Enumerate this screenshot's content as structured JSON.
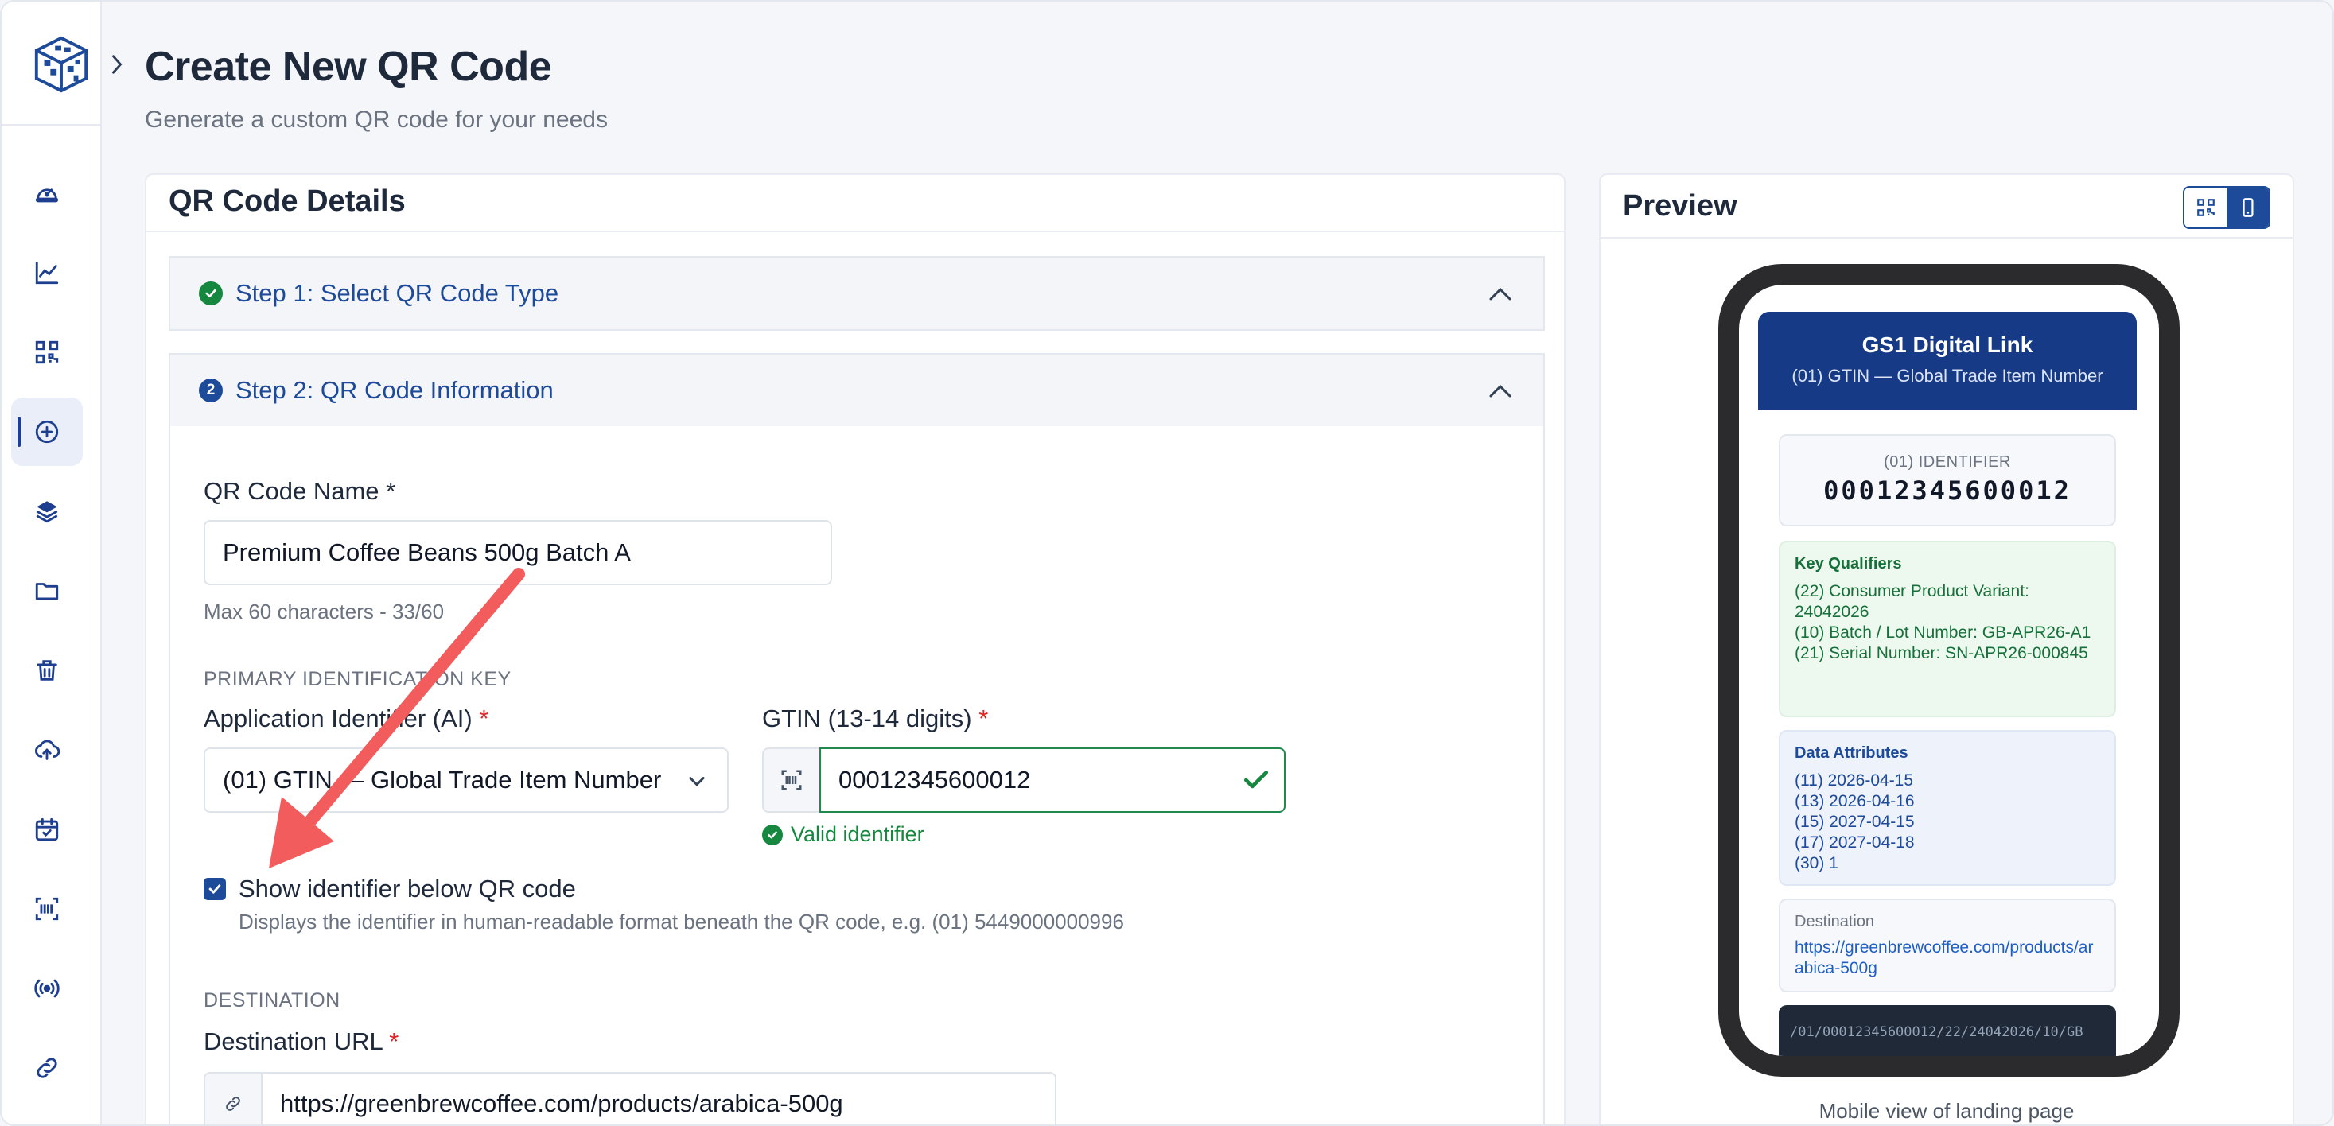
{
  "header": {
    "title": "Create New QR Code",
    "subtitle": "Generate a custom QR code for your needs"
  },
  "sidebar": {
    "items": [
      {
        "name": "dashboard",
        "icon": "gauge-icon"
      },
      {
        "name": "analytics",
        "icon": "line-chart-icon"
      },
      {
        "name": "qr-codes",
        "icon": "qr-icon"
      },
      {
        "name": "create",
        "icon": "plus-circle-icon",
        "active": true
      },
      {
        "name": "layers",
        "icon": "layers-icon"
      },
      {
        "name": "folders",
        "icon": "folder-icon"
      },
      {
        "name": "trash",
        "icon": "trash-icon"
      },
      {
        "name": "upload",
        "icon": "cloud-upload-icon"
      },
      {
        "name": "calendar",
        "icon": "calendar-check-icon"
      },
      {
        "name": "barcode",
        "icon": "barcode-scan-icon"
      },
      {
        "name": "broadcast",
        "icon": "broadcast-icon"
      },
      {
        "name": "links",
        "icon": "link-icon"
      }
    ]
  },
  "details": {
    "title": "QR Code Details",
    "step1": {
      "label": "Step 1: Select QR Code Type",
      "status": "complete"
    },
    "step2": {
      "label": "Step 2: QR Code Information",
      "number": "2"
    },
    "name_field": {
      "label": "QR Code Name",
      "required_mark": "*",
      "value": "Premium Coffee Beans 500g Batch A",
      "helper": "Max 60 characters - 33/60"
    },
    "primary_key": {
      "section_label": "PRIMARY IDENTIFICATION KEY",
      "ai_label": "Application Identifier (AI)",
      "ai_value": "(01) GTIN — Global Trade Item Number",
      "gtin_label": "GTIN (13-14 digits)",
      "gtin_value": "00012345600012",
      "valid_text": "Valid identifier",
      "required_mark": "*"
    },
    "show_identifier": {
      "checked": true,
      "label": "Show identifier below QR code",
      "helper": "Displays the identifier in human-readable format beneath the QR code, e.g. (01) 5449000000996"
    },
    "destination": {
      "section_label": "DESTINATION",
      "url_label": "Destination URL",
      "required_mark": "*",
      "url_value": "https://greenbrewcoffee.com/products/arabica-500g"
    }
  },
  "preview": {
    "title": "Preview",
    "view_mode": "mobile",
    "caption": "Mobile view of landing page",
    "landing": {
      "title": "GS1 Digital Link",
      "subtitle": "(01) GTIN — Global Trade Item Number",
      "id_label": "(01) IDENTIFIER",
      "id_value": "00012345600012",
      "key_qualifiers_title": "Key Qualifiers",
      "key_qualifiers": [
        "(22) Consumer Product Variant: 24042026",
        "(10) Batch / Lot Number: GB-APR26-A1",
        "(21) Serial Number: SN-APR26-000845"
      ],
      "data_attributes_title": "Data Attributes",
      "data_attributes": [
        "(11) 2026-04-15",
        "(13) 2026-04-16",
        "(15) 2027-04-15",
        "(17) 2027-04-18",
        "(30) 1"
      ],
      "destination_title": "Destination",
      "destination_url": "https://greenbrewcoffee.com/products/arabica-500g",
      "path": "/01/00012345600012/22/24042026/10/GB"
    }
  },
  "colors": {
    "brand": "#1e4a9a",
    "success": "#16873f",
    "annotation_arrow": "#f25c5c"
  }
}
